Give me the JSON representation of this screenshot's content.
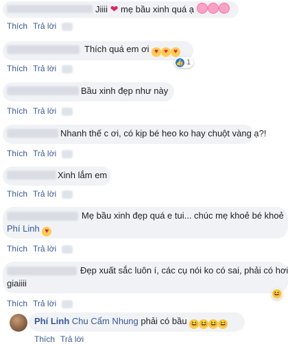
{
  "actions": {
    "like": "Thích",
    "reply": "Trả lời"
  },
  "comments": [
    {
      "text": "Jiiii",
      "tail": "mẹ bầu xinh quá ạ"
    },
    {
      "text": "Thích quá em ơi",
      "reactions": "1"
    },
    {
      "text": "Bầu xinh đẹp như này"
    },
    {
      "text": "Nhanh thế c ơi, có kịp bé heo ko hay chuột vàng ạ?!"
    },
    {
      "text": "Xinh lắm em"
    },
    {
      "text": "Mẹ bầu xinh đẹp quá e tui... chúc mẹ khoẻ bé khoẻ",
      "mention": "Phí Linh"
    },
    {
      "text": "Đẹp xuất sắc luôn í, các cụ nói ko có sai, phải có hơi",
      "text2": "giaiiii"
    },
    {
      "name": "Phí Linh",
      "mention": "Chu Cẩm Nhung",
      "text": "phải có bầu"
    }
  ],
  "icons": [
    "red-heart-icon",
    "bouquet-icon",
    "smiling-face-with-hearts-icon",
    "like-icon",
    "laughing-face-icon"
  ]
}
